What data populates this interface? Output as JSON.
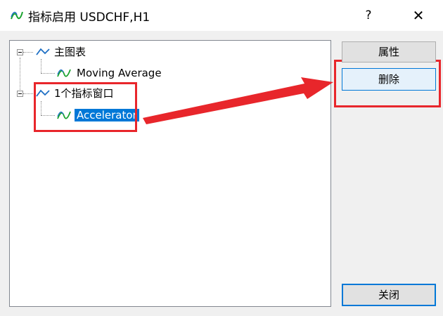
{
  "window": {
    "title": "指标启用 USDCHF,H1",
    "help_label": "?",
    "close_label": "✕"
  },
  "tree": {
    "items": [
      {
        "label": "主图表"
      },
      {
        "label": "Moving Average"
      },
      {
        "label": "1个指标窗口"
      },
      {
        "label": "Accelerator",
        "selected": true
      }
    ]
  },
  "buttons": {
    "properties_label": "属性",
    "delete_label": "删除",
    "close_label": "关闭"
  },
  "colors": {
    "accent": "#0078d7",
    "annotation": "#e8262b",
    "chart_icon": "#1e6fc4",
    "indicator_icon": "#1aa32e"
  }
}
